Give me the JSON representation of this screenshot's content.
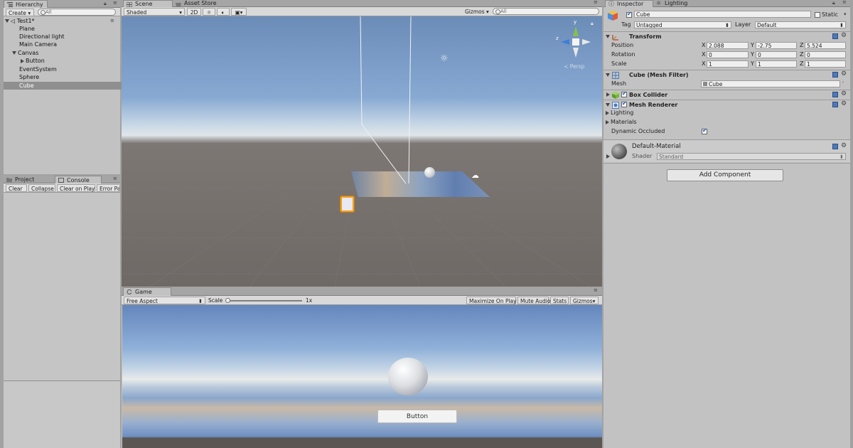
{
  "hierarchy": {
    "tab_label": "Hierarchy",
    "create_label": "Create",
    "search_placeholder": "All",
    "scene_name": "Test1*",
    "items": [
      {
        "label": "Plane"
      },
      {
        "label": "Directional light"
      },
      {
        "label": "Main Camera"
      },
      {
        "label": "Canvas"
      },
      {
        "label": "Button"
      },
      {
        "label": "EventSystem"
      },
      {
        "label": "Sphere"
      },
      {
        "label": "Cube"
      }
    ]
  },
  "project_console": {
    "tabs": [
      {
        "label": "Project"
      },
      {
        "label": "Console"
      }
    ],
    "buttons": [
      {
        "label": "Clear"
      },
      {
        "label": "Collapse"
      },
      {
        "label": "Clear on Play"
      },
      {
        "label": "Error Pau"
      }
    ]
  },
  "scene": {
    "tabs": [
      {
        "label": "Scene"
      },
      {
        "label": "Asset Store"
      }
    ],
    "shading": "Shaded",
    "mode_2d": "2D",
    "gizmos": "Gizmos",
    "search_placeholder": "All",
    "persp_label": "Persp",
    "gizmo_axes": {
      "y": "y",
      "z": "z"
    }
  },
  "game": {
    "tab_label": "Game",
    "aspect": "Free Aspect",
    "scale_label": "Scale",
    "scale_value": "1x",
    "buttons": [
      {
        "label": "Maximize On Play"
      },
      {
        "label": "Mute Audio"
      },
      {
        "label": "Stats"
      },
      {
        "label": "Gizmos"
      }
    ],
    "ui_button_label": "Button"
  },
  "inspector": {
    "tabs": [
      {
        "label": "Inspector"
      },
      {
        "label": "Lighting"
      }
    ],
    "object_name": "Cube",
    "static_label": "Static",
    "tag_label": "Tag",
    "tag_value": "Untagged",
    "layer_label": "Layer",
    "layer_value": "Default",
    "transform": {
      "title": "Transform",
      "position": {
        "label": "Position",
        "x": "2.088",
        "y": "-2.75",
        "z": "5.524"
      },
      "rotation": {
        "label": "Rotation",
        "x": "0",
        "y": "0",
        "z": "0"
      },
      "scale": {
        "label": "Scale",
        "x": "1",
        "y": "1",
        "z": "1"
      },
      "axis_x": "X",
      "axis_y": "Y",
      "axis_z": "Z"
    },
    "mesh_filter": {
      "title": "Cube (Mesh Filter)",
      "mesh_label": "Mesh",
      "mesh_value": "Cube"
    },
    "box_collider": {
      "title": "Box Collider"
    },
    "mesh_renderer": {
      "title": "Mesh Renderer",
      "lighting_label": "Lighting",
      "materials_label": "Materials",
      "dynamic_occluded_label": "Dynamic Occluded"
    },
    "material": {
      "name": "Default-Material",
      "shader_label": "Shader",
      "shader_value": "Standard"
    },
    "add_component_label": "Add Component"
  }
}
